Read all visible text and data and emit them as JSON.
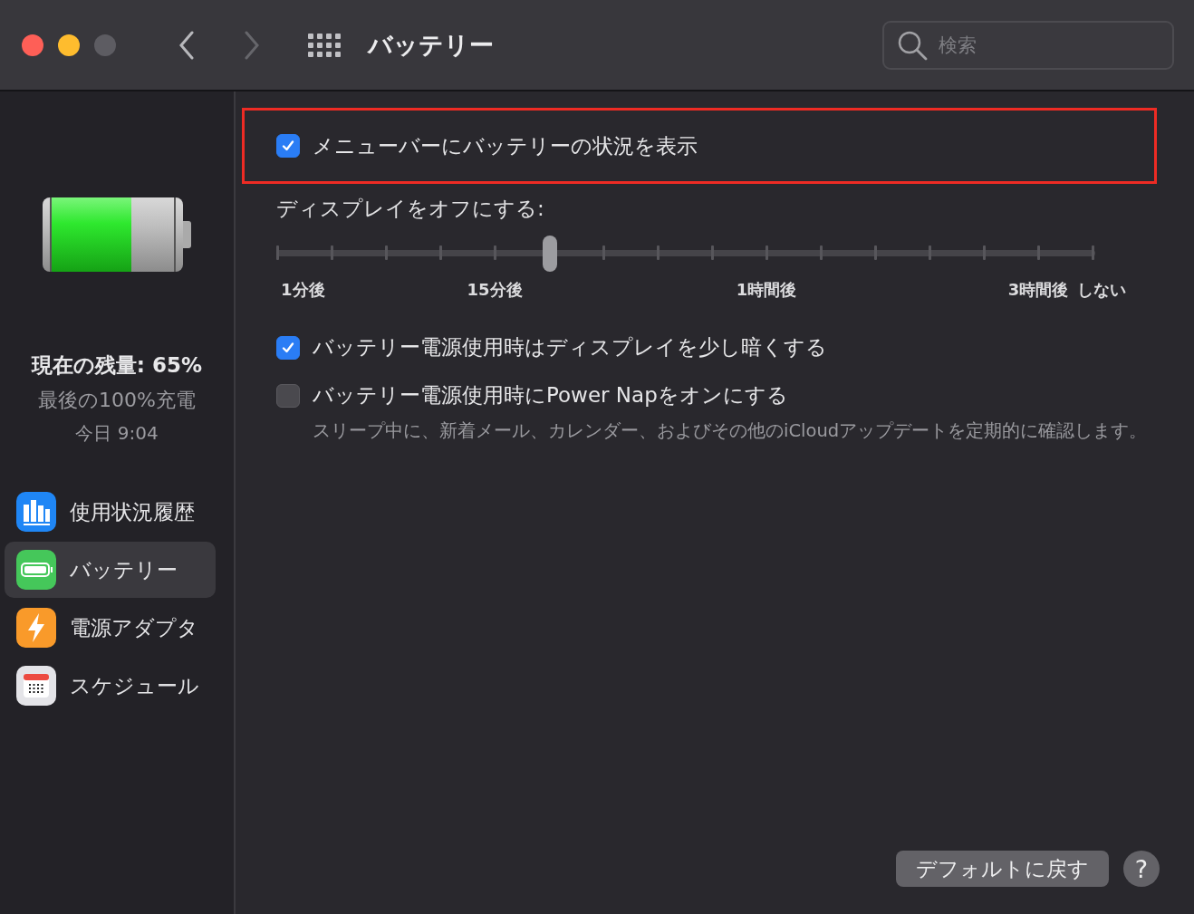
{
  "window": {
    "title": "バッテリー"
  },
  "search": {
    "placeholder": "検索"
  },
  "battery": {
    "level": 0.65,
    "current": "現在の残量: 65%",
    "last_full_label": "最後の100%充電",
    "last_full_time": "今日 9:04"
  },
  "sidebar": {
    "items": [
      {
        "label": "使用状況履歴",
        "kind": "usage",
        "selected": false
      },
      {
        "label": "バッテリー",
        "kind": "battery",
        "selected": true
      },
      {
        "label": "電源アダプタ",
        "kind": "power",
        "selected": false
      },
      {
        "label": "スケジュール",
        "kind": "schedule",
        "selected": false
      }
    ]
  },
  "menu_bar_option": {
    "label": "メニューバーにバッテリーの状況を表示",
    "checked": true,
    "highlighted": true
  },
  "display_off": {
    "label": "ディスプレイをオフにする:",
    "level": 0.3333,
    "tick_labels": [
      "1分後",
      "15分後",
      "1時間後",
      "3時間後",
      "しない"
    ]
  },
  "options": [
    {
      "label": "バッテリー電源使用時はディスプレイを少し暗くする",
      "checked": true
    },
    {
      "label": "バッテリー電源使用時にPower Napをオンにする",
      "checked": false,
      "description": "スリープ中に、新着メール、カレンダー、およびその他のiCloudアップデートを定期的に確認します。"
    }
  ],
  "buttons": {
    "restore_defaults": "デフォルトに戻す",
    "help": "?"
  }
}
